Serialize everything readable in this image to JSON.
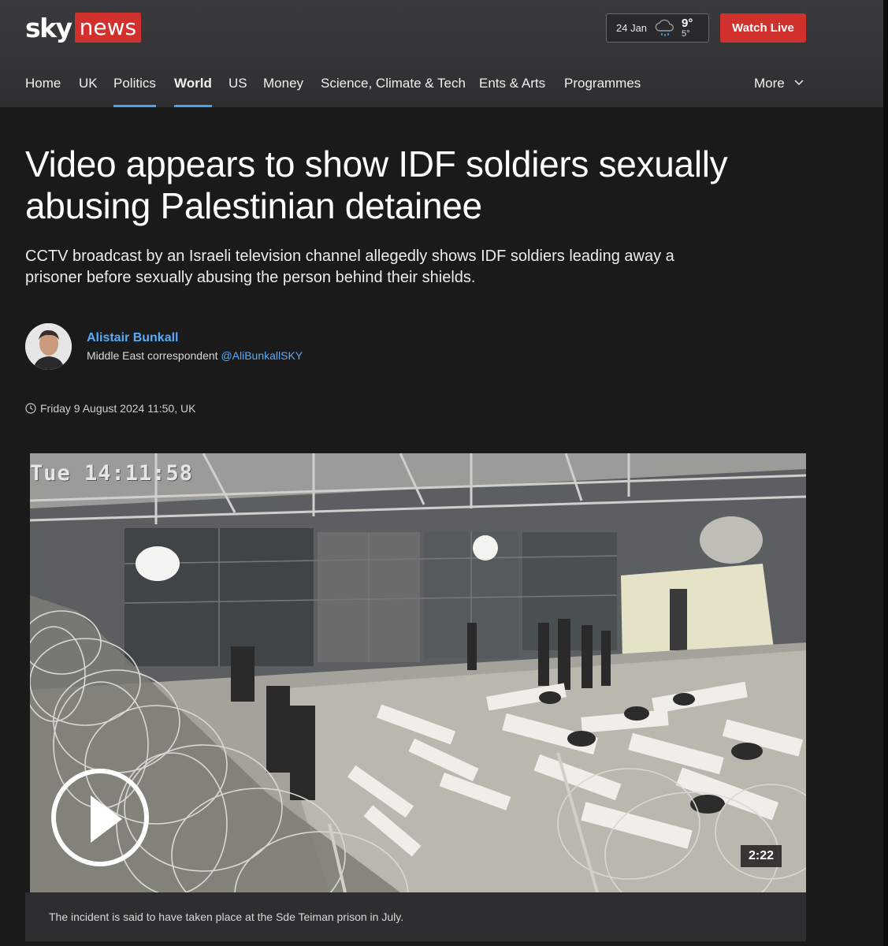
{
  "header": {
    "logo": {
      "sky": "sky",
      "news": "news"
    },
    "weather": {
      "date": "24 Jan",
      "icon": "rain-cloud-icon",
      "high": "9°",
      "low": "5°"
    },
    "watch_live_label": "Watch Live",
    "nav": [
      {
        "label": "Home"
      },
      {
        "label": "UK"
      },
      {
        "label": "Politics"
      },
      {
        "label": "World"
      },
      {
        "label": "US"
      },
      {
        "label": "Money"
      },
      {
        "label": "Science, Climate & Tech"
      },
      {
        "label": "Ents & Arts"
      },
      {
        "label": "Programmes"
      }
    ],
    "more_label": "More",
    "active_item": "World"
  },
  "article": {
    "headline": "Video appears to show IDF soldiers sexually abusing Palestinian detainee",
    "standfirst": "CCTV broadcast by an Israeli television channel allegedly shows IDF soldiers leading away a prisoner before sexually abusing the person behind their shields.",
    "author": {
      "name": "Alistair Bunkall",
      "role": "Middle East correspondent",
      "handle": "@AliBunkallSKY"
    },
    "timestamp": "Friday 9 August 2024 11:50, UK"
  },
  "video": {
    "cctv_overlay": "Tue 14:11:58",
    "duration": "2:22",
    "caption": "The incident is said to have taken place at the Sde Teiman prison in July."
  },
  "colors": {
    "brand_red": "#d0312d",
    "link_blue": "#5aaaf5",
    "nav_underline": "#4aa3ef",
    "background": "#1a1a1b"
  }
}
